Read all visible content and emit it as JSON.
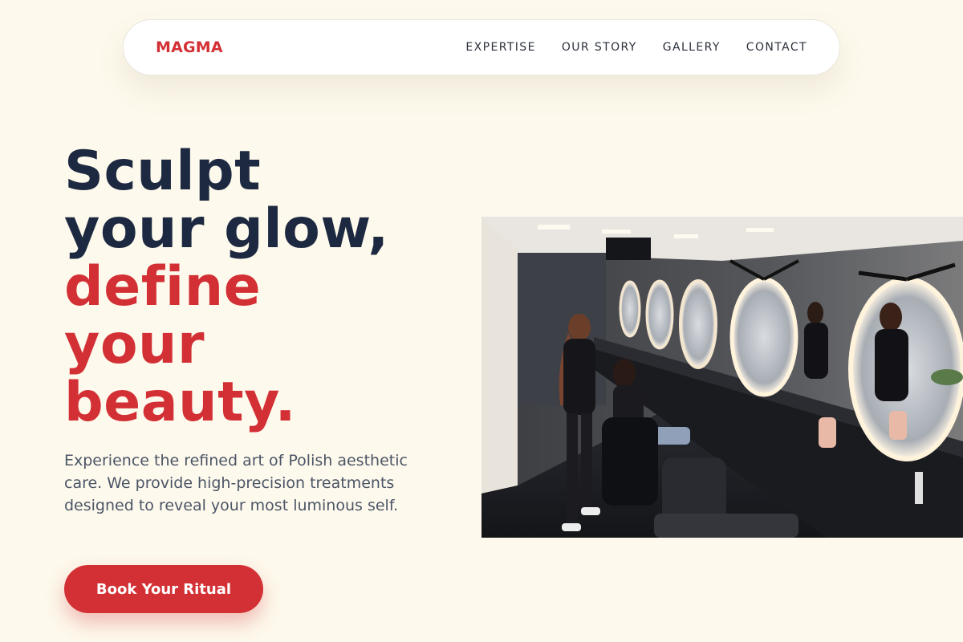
{
  "brand": {
    "name": "MAGMA",
    "accent_color": "#d33035",
    "heading_color": "#1c2940",
    "background_color": "#fdf9ec"
  },
  "nav": {
    "items": [
      {
        "label": "EXPERTISE"
      },
      {
        "label": "OUR STORY"
      },
      {
        "label": "GALLERY"
      },
      {
        "label": "CONTACT"
      }
    ]
  },
  "hero": {
    "title_lines": [
      "Sculpt",
      "your glow,"
    ],
    "title_accent_lines": [
      "define",
      "your",
      "beauty."
    ],
    "description": "Experience the refined art of Polish aesthetic care. We provide high-precision treatments designed to reveal your most luminous self.",
    "cta_label": "Book Your Ritual"
  },
  "image": {
    "alt": "Hairdresser styling a client's hair in a salon with round illuminated mirrors"
  }
}
